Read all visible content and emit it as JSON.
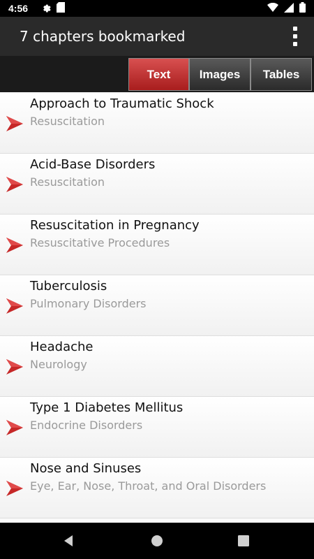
{
  "status_bar": {
    "time": "4:56",
    "icons": [
      "settings-icon",
      "sd-card-icon",
      "wifi-icon",
      "signal-icon",
      "battery-icon"
    ]
  },
  "app_bar": {
    "title": "7 chapters bookmarked",
    "menu_icon": "overflow-menu-icon"
  },
  "tabs": [
    {
      "label": "Text",
      "active": true
    },
    {
      "label": "Images",
      "active": false
    },
    {
      "label": "Tables",
      "active": false
    }
  ],
  "bookmarks": [
    {
      "title": "Approach to Traumatic Shock",
      "section": "Resuscitation"
    },
    {
      "title": "Acid-Base Disorders",
      "section": "Resuscitation"
    },
    {
      "title": "Resuscitation in Pregnancy",
      "section": "Resuscitative Procedures"
    },
    {
      "title": "Tuberculosis",
      "section": "Pulmonary Disorders"
    },
    {
      "title": "Headache",
      "section": "Neurology"
    },
    {
      "title": "Type 1 Diabetes Mellitus",
      "section": "Endocrine Disorders"
    },
    {
      "title": "Nose and Sinuses",
      "section": "Eye, Ear, Nose, Throat, and Oral Disorders"
    }
  ],
  "nav_bar": {
    "icons": [
      "back-icon",
      "home-icon",
      "recents-icon"
    ]
  },
  "colors": {
    "accent_red": "#c62828",
    "app_bar": "#2a2a2a",
    "subtitle_gray": "#9a9a9a"
  }
}
